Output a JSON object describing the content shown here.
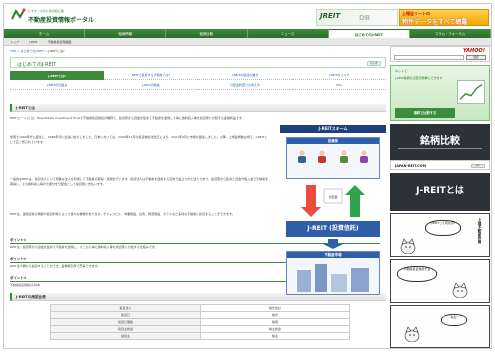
{
  "header": {
    "logo_sub": "ビギナーズのための初心者",
    "logo_title": "不動産投資情報ポータル",
    "banner_a_logo": "JREIT",
    "banner_a_db": "DB",
    "banner_b_line1": "上場全リートの",
    "banner_b_line2": "物件データをすべて網羅"
  },
  "nav": {
    "items": [
      "ホーム",
      "銘柄情報",
      "銘柄比較",
      "ニュース",
      "はじめてのJ-REIT",
      "コラム・フォーラム"
    ],
    "active_index": 4
  },
  "subnav": {
    "items": [
      "トップ",
      "J-REIT",
      "不動産投資用語集"
    ]
  },
  "breadcrumb": {
    "root": "TOP",
    "middle": "はじめてのJ-REIT",
    "current": "J-REITとは?"
  },
  "page": {
    "title": "はじめてのJ-REIT",
    "badge": "初心者",
    "tabs_row1": [
      "J-REITとは?",
      "REITで投資する不動産とは?",
      "J-REITの投資の魅力",
      "J-REITのリスク"
    ],
    "tabs_row2": [
      "J-REITの仕組み",
      "J-REITの税金",
      "分配金利回りの考え方",
      "FAQ"
    ],
    "active_tab": 0,
    "section_title": "J-REITとは",
    "para1": "REIT(リート)とは、Real Estate Investment Trustで不動産投資信託の略称で、投資家から資金を集めて不動産を運用して得た賃料収入等を投資家に分配する金融商品です。",
    "para2": "米国で1960年代に誕生し、1980年代に急速に拡大しました。日本においては、2000年11月の投資信託法改正により、2001年9月に市場が誕生しました。以降、上場銘柄数は増え、J-REITとして広く知られています。",
    "para3": "一般的なREITは、投資法人という特殊な法人を利用して不動産の取得・運用を行います。投資法人は不動産を運用する目的で設立された法人であり、投資家から集めた資金や借入金で不動産を取得し、その賃料収入等の大部分を分配金として投資家に支払います。",
    "para4": "REITは、運用資産の規模や投資対象によって様々な種類があります。オフィスビル、商業施設、住宅、物流施設、ホテルなど多様な不動産に投資することができます。",
    "sub1": "ポイント①",
    "sub1_text": "REITは、投資家から資金を集めて不動産を運用し、そこから得た賃料収入等を投資家に分配する仕組みです。",
    "sub2": "ポイント②",
    "sub2_text": "REITは少額から投資することができ、証券取引所で売買できます。",
    "sub3": "ポイント③",
    "sub3_text": "不動産投資信託の基本",
    "table_title": "J-REITの用語比較",
    "table_rows": [
      [
        "投資法人",
        "株式会社"
      ],
      [
        "投資口",
        "株式"
      ],
      [
        "投資口価格",
        "株価"
      ],
      [
        "投資主総会",
        "株主総会"
      ],
      [
        "投資主",
        "株主"
      ]
    ]
  },
  "scheme": {
    "title": "J-REITスキーム",
    "investors": "投資家",
    "reit": "J-REIT (投資信託)",
    "realestate": "不動産市場",
    "arrow_label": "分配金"
  },
  "sidebar": {
    "search_logo": "YAHOO!",
    "search_placeholder": "",
    "search_button": "検索",
    "ad_green_1": "ネットで",
    "ad_green_2": "J-REIT銘柄の比較が簡単にできます",
    "ad_green_3": "無料で比較する",
    "ad_dark_title": "銘柄比較",
    "ad_url": "JAPAN-REIT.COM",
    "ad_url_badge": "REIT",
    "card_title": "J-REITとは",
    "comic_1": "J-REITって何なの?",
    "comic_2": "不動産投資信託だよ",
    "comic_3": "先生!",
    "comic_side": "上場不動産投資"
  },
  "colors": {
    "brand_green": "#3d8b3d",
    "dark_green": "#1f5f2a",
    "scheme_blue": "#2f5fa8",
    "link_blue": "#1a5fb4"
  }
}
